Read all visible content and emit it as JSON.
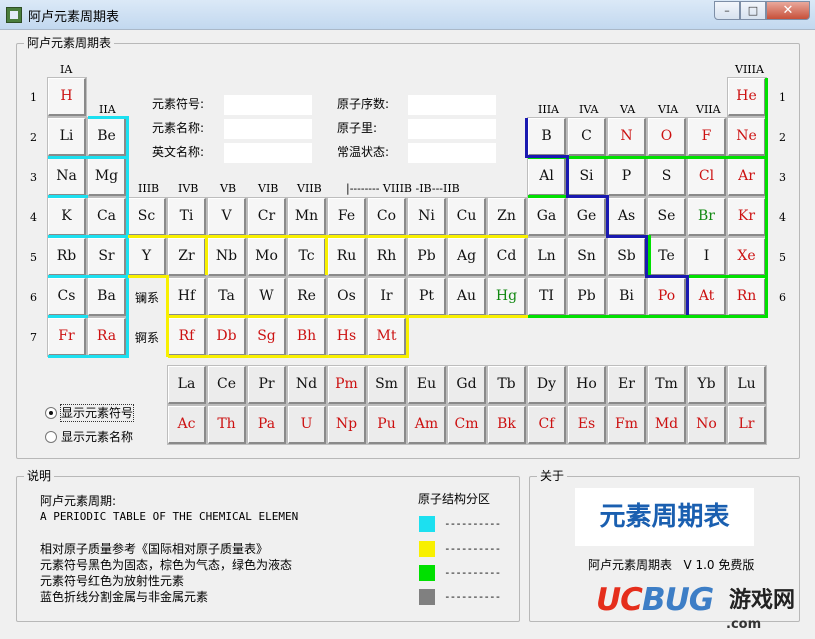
{
  "window": {
    "title": "阿卢元素周期表",
    "min": "–",
    "max": "□",
    "close": "✕",
    "icon": "chemistry-app-icon"
  },
  "main_group": {
    "title": "阿卢元素周期表",
    "info_fields": {
      "symbol_label": "元素符号:",
      "name_label": "元素名称:",
      "english_label": "英文名称:",
      "number_label": "原子序数:",
      "mass_label": "原子里:",
      "state_label": "常温状态:",
      "symbol_value": "",
      "name_value": "",
      "english_value": "",
      "number_value": "",
      "mass_value": "",
      "state_value": ""
    },
    "group_labels": {
      "IA": "IA",
      "IIA": "IIA",
      "IIIA": "IIIA",
      "IVA": "IVA",
      "VA": "VA",
      "VIA": "VIA",
      "VIIA": "VIIA",
      "VIIIA": "VIIIA",
      "IIIB": "IIIB",
      "IVB": "IVB",
      "VB": "VB",
      "VIB": "VIB",
      "VIIB": "VIIB",
      "VIIIB": "|-------- VIIIB -IB---IIB"
    },
    "period_labels": [
      "1",
      "2",
      "3",
      "4",
      "5",
      "6",
      "7"
    ],
    "series_labels": {
      "lanthanide": "镧系",
      "actinide": "锕系"
    },
    "main_rows": [
      [
        [
          "H",
          "red"
        ],
        null,
        null,
        null,
        null,
        null,
        null,
        null,
        null,
        null,
        null,
        null,
        null,
        null,
        null,
        null,
        null,
        [
          "He",
          "red"
        ]
      ],
      [
        [
          "Li",
          "black"
        ],
        [
          "Be",
          "black"
        ],
        null,
        null,
        null,
        null,
        null,
        null,
        null,
        null,
        null,
        null,
        [
          "B",
          "black"
        ],
        [
          "C",
          "black"
        ],
        [
          "N",
          "red"
        ],
        [
          "O",
          "red"
        ],
        [
          "F",
          "red"
        ],
        [
          "Ne",
          "red"
        ]
      ],
      [
        [
          "Na",
          "black"
        ],
        [
          "Mg",
          "black"
        ],
        null,
        null,
        null,
        null,
        null,
        null,
        null,
        null,
        null,
        null,
        [
          "Al",
          "black"
        ],
        [
          "Si",
          "black"
        ],
        [
          "P",
          "black"
        ],
        [
          "S",
          "black"
        ],
        [
          "Cl",
          "red"
        ],
        [
          "Ar",
          "red"
        ]
      ],
      [
        [
          "K",
          "black"
        ],
        [
          "Ca",
          "black"
        ],
        [
          "Sc",
          "black"
        ],
        [
          "Ti",
          "black"
        ],
        [
          "V",
          "black"
        ],
        [
          "Cr",
          "black"
        ],
        [
          "Mn",
          "black"
        ],
        [
          "Fe",
          "black"
        ],
        [
          "Co",
          "black"
        ],
        [
          "Ni",
          "black"
        ],
        [
          "Cu",
          "black"
        ],
        [
          "Zn",
          "black"
        ],
        [
          "Ga",
          "black"
        ],
        [
          "Ge",
          "black"
        ],
        [
          "As",
          "black"
        ],
        [
          "Se",
          "black"
        ],
        [
          "Br",
          "green"
        ],
        [
          "Kr",
          "red"
        ]
      ],
      [
        [
          "Rb",
          "black"
        ],
        [
          "Sr",
          "black"
        ],
        [
          "Y",
          "black"
        ],
        [
          "Zr",
          "black"
        ],
        [
          "Nb",
          "black"
        ],
        [
          "Mo",
          "black"
        ],
        [
          "Tc",
          "black"
        ],
        [
          "Ru",
          "black"
        ],
        [
          "Rh",
          "black"
        ],
        [
          "Pb",
          "black"
        ],
        [
          "Ag",
          "black"
        ],
        [
          "Cd",
          "black"
        ],
        [
          "Ln",
          "black"
        ],
        [
          "Sn",
          "black"
        ],
        [
          "Sb",
          "black"
        ],
        [
          "Te",
          "black"
        ],
        [
          "I",
          "black"
        ],
        [
          "Xe",
          "red"
        ]
      ],
      [
        [
          "Cs",
          "black"
        ],
        [
          "Ba",
          "black"
        ],
        null,
        [
          "Hf",
          "black"
        ],
        [
          "Ta",
          "black"
        ],
        [
          "W",
          "black"
        ],
        [
          "Re",
          "black"
        ],
        [
          "Os",
          "black"
        ],
        [
          "Ir",
          "black"
        ],
        [
          "Pt",
          "black"
        ],
        [
          "Au",
          "black"
        ],
        [
          "Hg",
          "green"
        ],
        [
          "TI",
          "black"
        ],
        [
          "Pb",
          "black"
        ],
        [
          "Bi",
          "black"
        ],
        [
          "Po",
          "red"
        ],
        [
          "At",
          "red"
        ],
        [
          "Rn",
          "red"
        ]
      ],
      [
        [
          "Fr",
          "red"
        ],
        [
          "Ra",
          "red"
        ],
        null,
        [
          "Rf",
          "red"
        ],
        [
          "Db",
          "red"
        ],
        [
          "Sg",
          "red"
        ],
        [
          "Bh",
          "red"
        ],
        [
          "Hs",
          "red"
        ],
        [
          "Mt",
          "red"
        ],
        null,
        null,
        null,
        null,
        null,
        null,
        null,
        null,
        null
      ]
    ],
    "lanthanides": [
      [
        "La",
        "black"
      ],
      [
        "Ce",
        "black"
      ],
      [
        "Pr",
        "black"
      ],
      [
        "Nd",
        "black"
      ],
      [
        "Pm",
        "red"
      ],
      [
        "Sm",
        "black"
      ],
      [
        "Eu",
        "black"
      ],
      [
        "Gd",
        "black"
      ],
      [
        "Tb",
        "black"
      ],
      [
        "Dy",
        "black"
      ],
      [
        "Ho",
        "black"
      ],
      [
        "Er",
        "black"
      ],
      [
        "Tm",
        "black"
      ],
      [
        "Yb",
        "black"
      ],
      [
        "Lu",
        "black"
      ]
    ],
    "actinides": [
      [
        "Ac",
        "red"
      ],
      [
        "Th",
        "red"
      ],
      [
        "Pa",
        "red"
      ],
      [
        "U",
        "red"
      ],
      [
        "Np",
        "red"
      ],
      [
        "Pu",
        "red"
      ],
      [
        "Am",
        "red"
      ],
      [
        "Cm",
        "red"
      ],
      [
        "Bk",
        "red"
      ],
      [
        "Cf",
        "red"
      ],
      [
        "Es",
        "red"
      ],
      [
        "Fm",
        "red"
      ],
      [
        "Md",
        "red"
      ],
      [
        "No",
        "red"
      ],
      [
        "Lr",
        "red"
      ]
    ],
    "display_mode": {
      "option_symbol": "显示元素符号",
      "option_name": "显示元素名称",
      "selected": "symbol"
    }
  },
  "notes_group": {
    "title": "说明",
    "heading": "阿卢元素周期:",
    "english_heading": "A PERIODIC TABLE OF THE CHEMICAL ELEMEN",
    "lines": [
      "相对原子质量参考《国际相对原子质量表》",
      "元素符号黑色为固态，棕色为气态，绿色为液态",
      "元素符号红色为放射性元素",
      "蓝色折线分割金属与非金属元素"
    ],
    "legend_title": "原子结构分区",
    "legend": [
      {
        "color": "#1ce0f0",
        "text": "----------"
      },
      {
        "color": "#f8f000",
        "text": "----------"
      },
      {
        "color": "#00e000",
        "text": "----------"
      },
      {
        "color": "#808080",
        "text": "----------"
      }
    ]
  },
  "about_group": {
    "title": "关于",
    "logo_text": "元素周期表",
    "version_line": "阿卢元素周期表   V 1.0 免费版"
  },
  "watermark": {
    "brand_uc": "UC",
    "brand_bug": "BUG",
    "brand_cn": "游戏网",
    "domain": ".com"
  },
  "colors": {
    "red": "#cc1111",
    "green": "#118811",
    "black": "#111111",
    "zone_s": "#1ce0f0",
    "zone_d": "#f8f000",
    "zone_p": "#00e000",
    "divider": "#1a1ab0"
  }
}
